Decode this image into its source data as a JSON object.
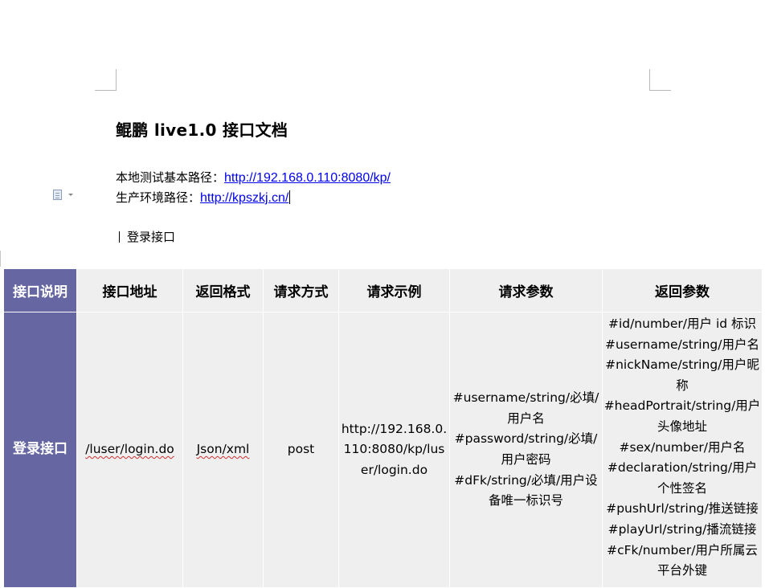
{
  "document": {
    "title": "鲲鹏 live1.0 接口文档",
    "local_path_label": "本地测试基本路径：",
    "local_path_url": "http://192.168.0.110:8080/kp/",
    "production_path_label": "生产环境路径：",
    "production_path_url": "http://kpszkj.cn/",
    "section_heading": "登录接口"
  },
  "table": {
    "headers": [
      "接口说明",
      "接口地址",
      "返回格式",
      "请求方式",
      "请求示例",
      "请求参数",
      "返回参数"
    ],
    "row": {
      "description": "登录接口",
      "address": "/luser/login.do",
      "format": "Json/xml",
      "method": "post",
      "example": "http://192.168.0.110:8080/kp/luser/login.do",
      "request_params": [
        "#username/string/必填/用户名",
        "#password/string/必填/用户密码",
        "#dFk/string/必填/用户设备唯一标识号"
      ],
      "response_params": [
        "#id/number/用户 id 标识",
        "#username/string/用户名",
        "#nickName/string/用户昵称",
        "#headPortrait/string/用户头像地址",
        "#sex/number/用户名",
        "#declaration/string/用户个性签名",
        "#pushUrl/string/推送链接",
        "#playUrl/string/播流链接",
        "#cFk/number/用户所属云平台外键"
      ]
    }
  },
  "icons": {
    "page_icon": "document-page-icon",
    "dropdown": "chevron-down-icon"
  },
  "colors": {
    "header_accent": "#6666a3",
    "cell_background": "#efefef",
    "link": "#0000ee",
    "spellcheck_underline": "#d03030"
  }
}
